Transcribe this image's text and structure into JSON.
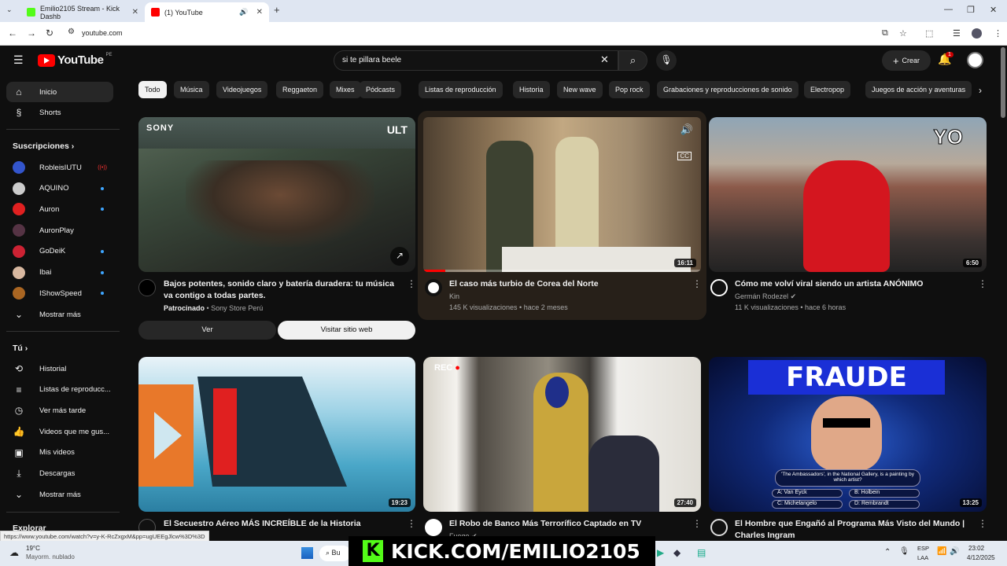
{
  "browser": {
    "tabs": [
      {
        "title": "Emilio2105 Stream - Kick Dashb",
        "active": false
      },
      {
        "title": "(1) YouTube",
        "active": true
      }
    ],
    "url": "youtube.com"
  },
  "youtube": {
    "logo_text": "YouTube",
    "country_code": "PE",
    "search_value": "si te pillara beele",
    "create_label": "Crear",
    "notification_count": "1"
  },
  "sidebar": {
    "main": [
      {
        "label": "Inicio",
        "icon": "home-icon"
      },
      {
        "label": "Shorts",
        "icon": "shorts-icon"
      }
    ],
    "subscriptions_title": "Suscripciones",
    "subscriptions": [
      {
        "label": "RobleisIUTU",
        "status": "live",
        "color": "#3355cc"
      },
      {
        "label": "AQUINO",
        "status": "new",
        "color": "#cccccc"
      },
      {
        "label": "Auron",
        "status": "new",
        "color": "#e02020"
      },
      {
        "label": "AuronPlay",
        "status": "",
        "color": "#553344"
      },
      {
        "label": "GoDeiK",
        "status": "new",
        "color": "#cc2233"
      },
      {
        "label": "Ibai",
        "status": "new",
        "color": "#d8b8a0"
      },
      {
        "label": "IShowSpeed",
        "status": "new",
        "color": "#aa6622"
      }
    ],
    "show_more": "Mostrar más",
    "you_title": "Tú",
    "you_items": [
      {
        "label": "Historial",
        "icon": "history-icon"
      },
      {
        "label": "Listas de reproducc...",
        "icon": "playlists-icon"
      },
      {
        "label": "Ver más tarde",
        "icon": "watch-later-icon"
      },
      {
        "label": "Videos que me gus...",
        "icon": "like-icon"
      },
      {
        "label": "Mis videos",
        "icon": "my-videos-icon"
      },
      {
        "label": "Descargas",
        "icon": "download-icon"
      },
      {
        "label": "Mostrar más",
        "icon": "chevron-down-icon"
      }
    ],
    "explore_title": "Explorar"
  },
  "chips": [
    "Todo",
    "Música",
    "Videojuegos",
    "Reggaeton",
    "Mixes",
    "Pódcasts",
    "Listas de reproducción",
    "Historia",
    "New wave",
    "Pop rock",
    "Grabaciones y reproducciones de sonido",
    "Electropop",
    "Juegos de acción y aventuras"
  ],
  "videos": [
    {
      "title": "Bajos potentes, sonido claro y batería duradera: tu música va contigo a todas partes.",
      "sponsor_label": "Patrocinado",
      "channel": "Sony Store Perú",
      "thumb_brand": "SONY",
      "thumb_logo": "ULT"
    },
    {
      "title": "El caso más turbio de Corea del Norte",
      "channel": "Kin",
      "meta": "145 K visualizaciones • hace 2 meses",
      "duration": "16:11"
    },
    {
      "title": "Cómo me volví viral siendo un artista ANÓNIMO",
      "channel": "Germán Rodezel",
      "meta": "11 K visualizaciones • hace 6 horas",
      "duration": "6:50",
      "thumb_text": "YO"
    },
    {
      "title": "El Secuestro Aéreo MÁS INCREÍBLE de la Historia",
      "duration": "19:23"
    },
    {
      "title": "El Robo de Banco Más Terrorífico Captado en TV",
      "channel": "Fuego",
      "duration": "27:40",
      "thumb_text": "REC"
    },
    {
      "title": "El Hombre que Engañó al Programa Más Visto del Mundo | Charles Ingram",
      "duration": "13:25",
      "thumb_text": "FRAUDE",
      "quiz_question": "'The Ambassadors', in the National Gallery, is a painting by which artist?",
      "quiz_answers": [
        "A: Van Eyck",
        "B: Holbein",
        "C: Michelangelo",
        "D: Rembrandt"
      ]
    }
  ],
  "ad_buttons": {
    "ver": "Ver",
    "visit": "Visitar sitio web"
  },
  "status_url": "https://www.youtube.com/watch?v=y-K-RcZxgxM&pp=ugUEEgJlcw%3D%3D",
  "overlay": {
    "kick_text": "KICK.COM/EMILIO2105"
  },
  "taskbar": {
    "weather_temp": "19°C",
    "weather_desc": "Mayorm. nublado",
    "search_label": "Bu",
    "lang": "ESP",
    "lang_sub": "LAA",
    "time": "23:02",
    "date": "4/12/2025"
  }
}
